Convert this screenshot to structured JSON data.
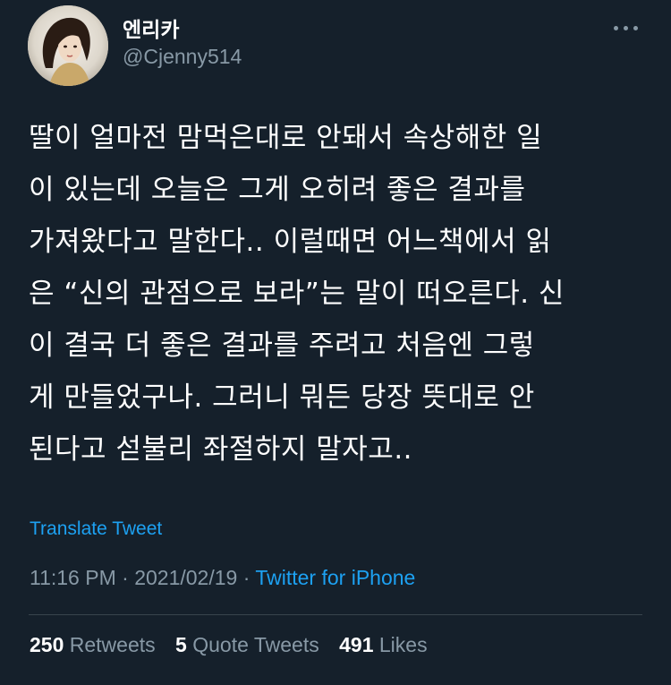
{
  "author": {
    "display_name": "엔리카",
    "handle": "@Cjenny514",
    "avatar_icon": "profile-photo"
  },
  "menu": {
    "icon": "more-horizontal-icon"
  },
  "tweet": {
    "lines": [
      "딸이 얼마전 맘먹은대로 안돼서 속상해한 일",
      "이 있는데 오늘은 그게 오히려 좋은 결과를",
      "가져왔다고 말한다.. 이럴때면 어느책에서 읽",
      "은 “신의 관점으로 보라”는 말이 떠오른다. 신",
      "이 결국 더 좋은 결과를 주려고 처음엔 그렇",
      "게 만들었구나. 그러니 뭐든 당장 뜻대로 안",
      "된다고 섣불리 좌절하지 말자고.."
    ],
    "translate_label": "Translate Tweet",
    "time": "11:16 PM",
    "separator": " · ",
    "date": "2021/02/19",
    "source": "Twitter for iPhone"
  },
  "stats": {
    "retweets_count": "250",
    "retweets_label": "Retweets",
    "quotes_count": "5",
    "quotes_label": "Quote Tweets",
    "likes_count": "491",
    "likes_label": "Likes"
  },
  "colors": {
    "background": "#15202b",
    "text": "#ffffff",
    "secondary": "#8899a6",
    "accent": "#1da1f2",
    "divider": "#38444d"
  }
}
